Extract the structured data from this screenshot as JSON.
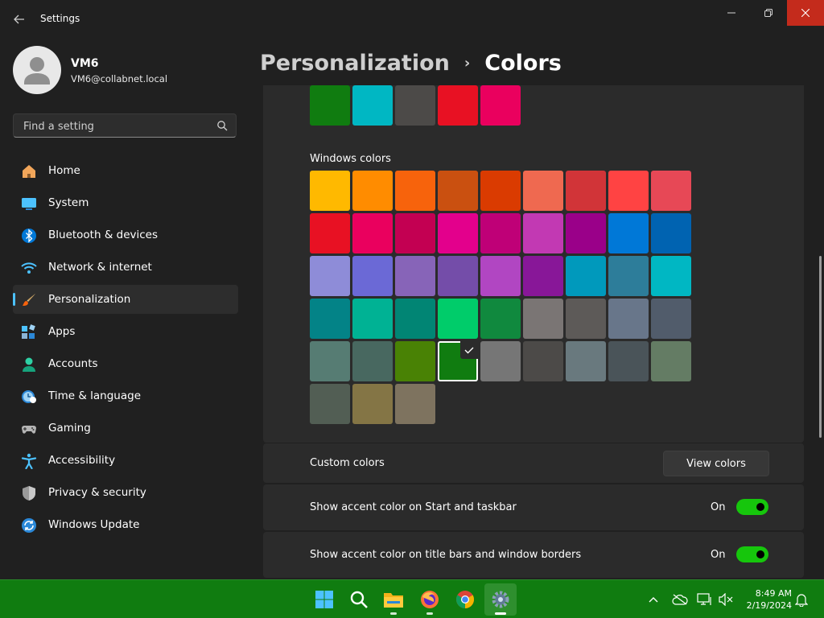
{
  "window": {
    "title": "Settings",
    "back_icon": "arrow-left-icon",
    "minimize_icon": "minimize-icon",
    "maximize_icon": "restore-icon",
    "close_icon": "close-icon",
    "close_color": "#c42b1c"
  },
  "profile": {
    "name": "VM6",
    "email": "VM6@collabnet.local"
  },
  "search": {
    "placeholder": "Find a setting",
    "value": ""
  },
  "sidebar": {
    "selected_indicator_color": "#4cc2ff",
    "items": [
      {
        "label": "Home",
        "icon": "home-icon",
        "selected": false
      },
      {
        "label": "System",
        "icon": "system-icon",
        "selected": false
      },
      {
        "label": "Bluetooth & devices",
        "icon": "bluetooth-icon",
        "selected": false
      },
      {
        "label": "Network & internet",
        "icon": "wifi-icon",
        "selected": false
      },
      {
        "label": "Personalization",
        "icon": "brush-icon",
        "selected": true
      },
      {
        "label": "Apps",
        "icon": "apps-icon",
        "selected": false
      },
      {
        "label": "Accounts",
        "icon": "accounts-icon",
        "selected": false
      },
      {
        "label": "Time & language",
        "icon": "time-language-icon",
        "selected": false
      },
      {
        "label": "Gaming",
        "icon": "gaming-icon",
        "selected": false
      },
      {
        "label": "Accessibility",
        "icon": "accessibility-icon",
        "selected": false
      },
      {
        "label": "Privacy & security",
        "icon": "shield-icon",
        "selected": false
      },
      {
        "label": "Windows Update",
        "icon": "update-icon",
        "selected": false
      }
    ]
  },
  "header": {
    "parent": "Personalization",
    "separator": "›",
    "current": "Colors"
  },
  "recent_colors": [
    "#107c10",
    "#00b7c3",
    "#4c4a48",
    "#e81123",
    "#ea005e"
  ],
  "windows_colors": {
    "label": "Windows colors",
    "selected": "#107c10",
    "swatches": [
      "#ffb900",
      "#ff8c00",
      "#f7630c",
      "#ca5010",
      "#da3b01",
      "#ef6950",
      "#d13438",
      "#ff4343",
      "#e74856",
      "#e81123",
      "#ea005e",
      "#c30052",
      "#e3008c",
      "#bf0077",
      "#c239b3",
      "#9a0089",
      "#0078d7",
      "#0063b1",
      "#8e8cd8",
      "#6b69d6",
      "#8764b8",
      "#744da9",
      "#b146c2",
      "#881798",
      "#0099bc",
      "#2d7d9a",
      "#00b7c3",
      "#038387",
      "#00b294",
      "#018574",
      "#00cc6a",
      "#10893e",
      "#7a7574",
      "#5d5a58",
      "#68768a",
      "#515c6b",
      "#567c73",
      "#486860",
      "#498205",
      "#107c10",
      "#767676",
      "#4c4a48",
      "#69797e",
      "#4a5459",
      "#647c64",
      "#525e54",
      "#847545",
      "#7e735f"
    ]
  },
  "custom_colors": {
    "label": "Custom colors",
    "button": "View colors"
  },
  "accent_start": {
    "label": "Show accent color on Start and taskbar",
    "state": "On",
    "on": true
  },
  "accent_titlebar": {
    "label": "Show accent color on title bars and window borders",
    "state": "On",
    "on": true
  },
  "taskbar": {
    "color": "#107c10",
    "apps": [
      "start-icon",
      "search-icon",
      "file-explorer-icon",
      "firefox-icon",
      "chrome-icon",
      "settings-icon"
    ],
    "tray": [
      "chevron-up-icon",
      "onedrive-icon",
      "network-icon",
      "volume-mute-icon",
      "notification-icon"
    ],
    "time": "8:49 AM",
    "date": "2/19/2024"
  }
}
